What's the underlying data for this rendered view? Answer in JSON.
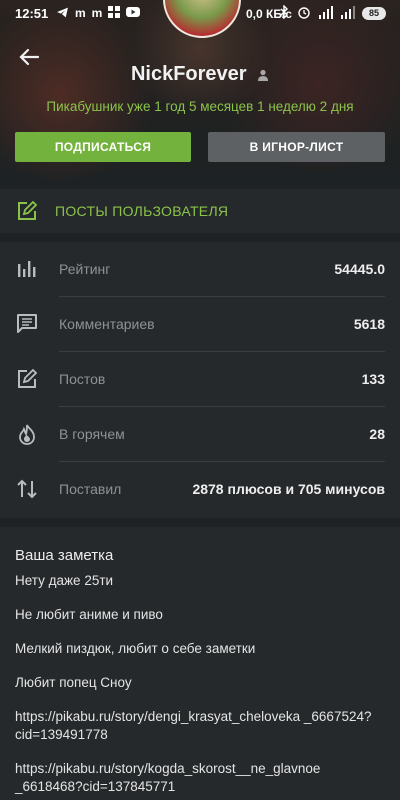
{
  "status_bar": {
    "time": "12:51",
    "speed": "0,0 КБ/с",
    "battery": "85"
  },
  "profile": {
    "username": "NickForever",
    "tenure": "Пикабушник уже 1 год 5 месяцев 1 неделю 2 дня",
    "subscribe_label": "ПОДПИСАТЬСЯ",
    "ignore_label": "В ИГНОР-ЛИСТ"
  },
  "posts_link": {
    "label": "ПОСТЫ ПОЛЬЗОВАТЕЛЯ"
  },
  "stats": [
    {
      "icon": "bar-chart-icon",
      "label": "Рейтинг",
      "value": "54445.0"
    },
    {
      "icon": "comment-icon",
      "label": "Комментариев",
      "value": "5618"
    },
    {
      "icon": "edit-icon",
      "label": "Постов",
      "value": "133"
    },
    {
      "icon": "flame-icon",
      "label": "В горячем",
      "value": "28"
    },
    {
      "icon": "swap-vertical-icon",
      "label": "Поставил",
      "value": "2878 плюсов и 705 минусов"
    }
  ],
  "note": {
    "title": "Ваша заметка",
    "lines": [
      "Нету даже 25ти",
      "Не любит аниме и пиво",
      "Мелкий пиздюк, любит о себе заметки",
      "Любит попец Сноу",
      "https://pikabu.ru/story/dengi_krasyat_cheloveka _6667524?cid=139491778",
      "https://pikabu.ru/story/kogda_skorost__ne_glavnoe _6618468?cid=137845771"
    ]
  },
  "colors": {
    "accent_green": "#8bc34a",
    "button_green": "#74b23e",
    "button_gray": "#5e6163",
    "background": "#1f2224",
    "card": "#25292b"
  }
}
